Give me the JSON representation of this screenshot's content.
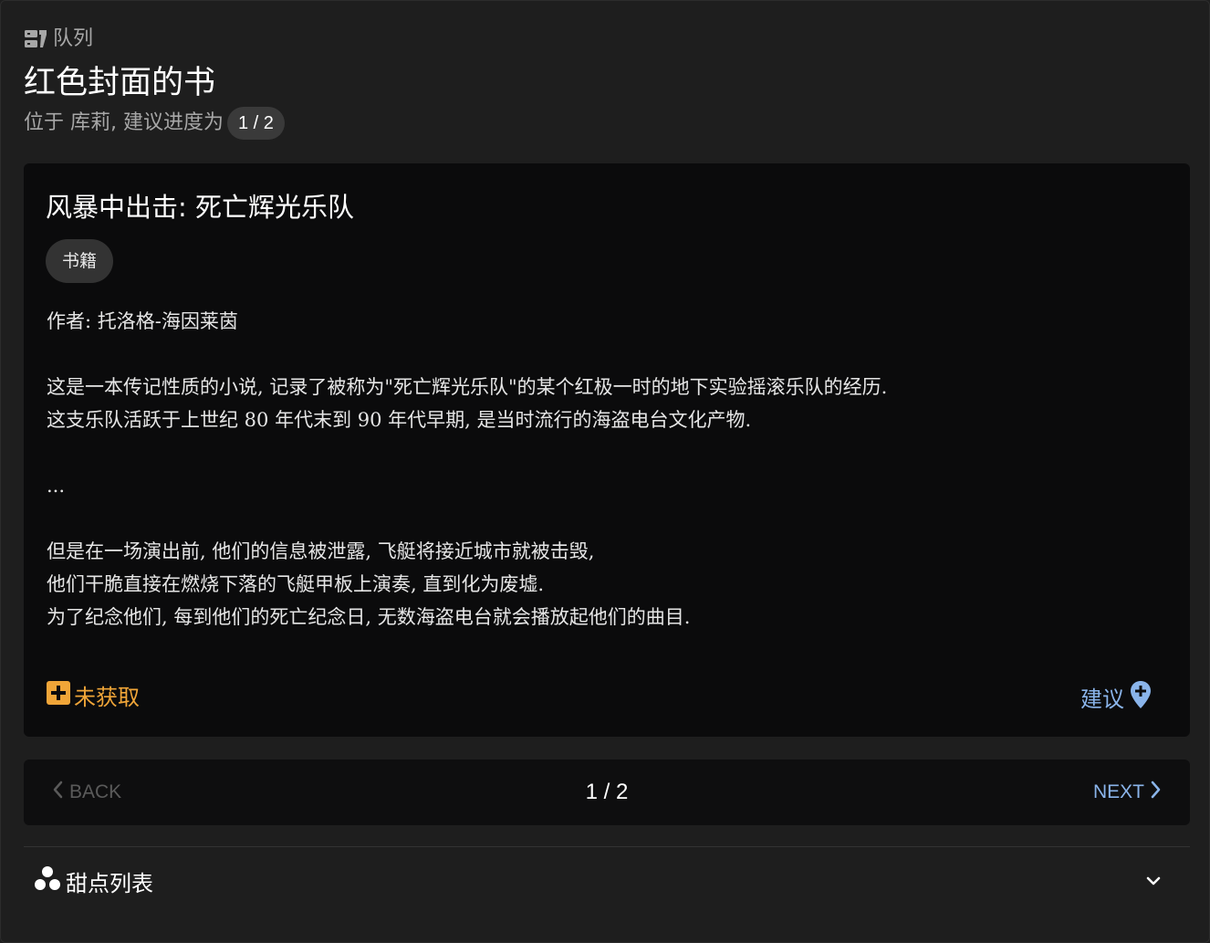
{
  "header": {
    "queue_label": "队列",
    "title": "红色封面的书",
    "subtitle": "位于 库莉, 建议进度为",
    "progress_badge": "1 / 2"
  },
  "card": {
    "book_title": "风暴中出击: 死亡辉光乐队",
    "tag": "书籍",
    "author": "作者: 托洛格-海因莱茵",
    "paragraph1": [
      "这是一本传记性质的小说, 记录了被称为\"死亡辉光乐队\"的某个红极一时的地下实验摇滚乐队的经历.",
      "这支乐队活跃于上世纪 80 年代末到 90 年代早期, 是当时流行的海盗电台文化产物."
    ],
    "ellipsis": "...",
    "paragraph2": [
      "但是在一场演出前, 他们的信息被泄露, 飞艇将接近城市就被击毁,",
      "他们干脆直接在燃烧下落的飞艇甲板上演奏, 直到化为废墟.",
      "为了纪念他们, 每到他们的死亡纪念日, 无数海盗电台就会播放起他们的曲目."
    ],
    "status_label": "未获取",
    "suggest_label": "建议"
  },
  "pager": {
    "back_label": "BACK",
    "page_indicator": "1 / 2",
    "next_label": "NEXT"
  },
  "dessert": {
    "label": "甜点列表"
  },
  "colors": {
    "background": "#1e1e1e",
    "card": "#0b0b0c",
    "accent_orange": "#f0a538",
    "accent_blue": "#8ab4ea",
    "muted_text": "#a7a7a7"
  },
  "icons": {
    "queue": "queue-icon",
    "not_obtained": "plus-box-icon",
    "suggest": "map-marker-plus-icon",
    "back": "chevron-left-icon",
    "next": "chevron-right-icon",
    "dessert": "dots-cluster-icon",
    "expand": "chevron-down-icon"
  }
}
